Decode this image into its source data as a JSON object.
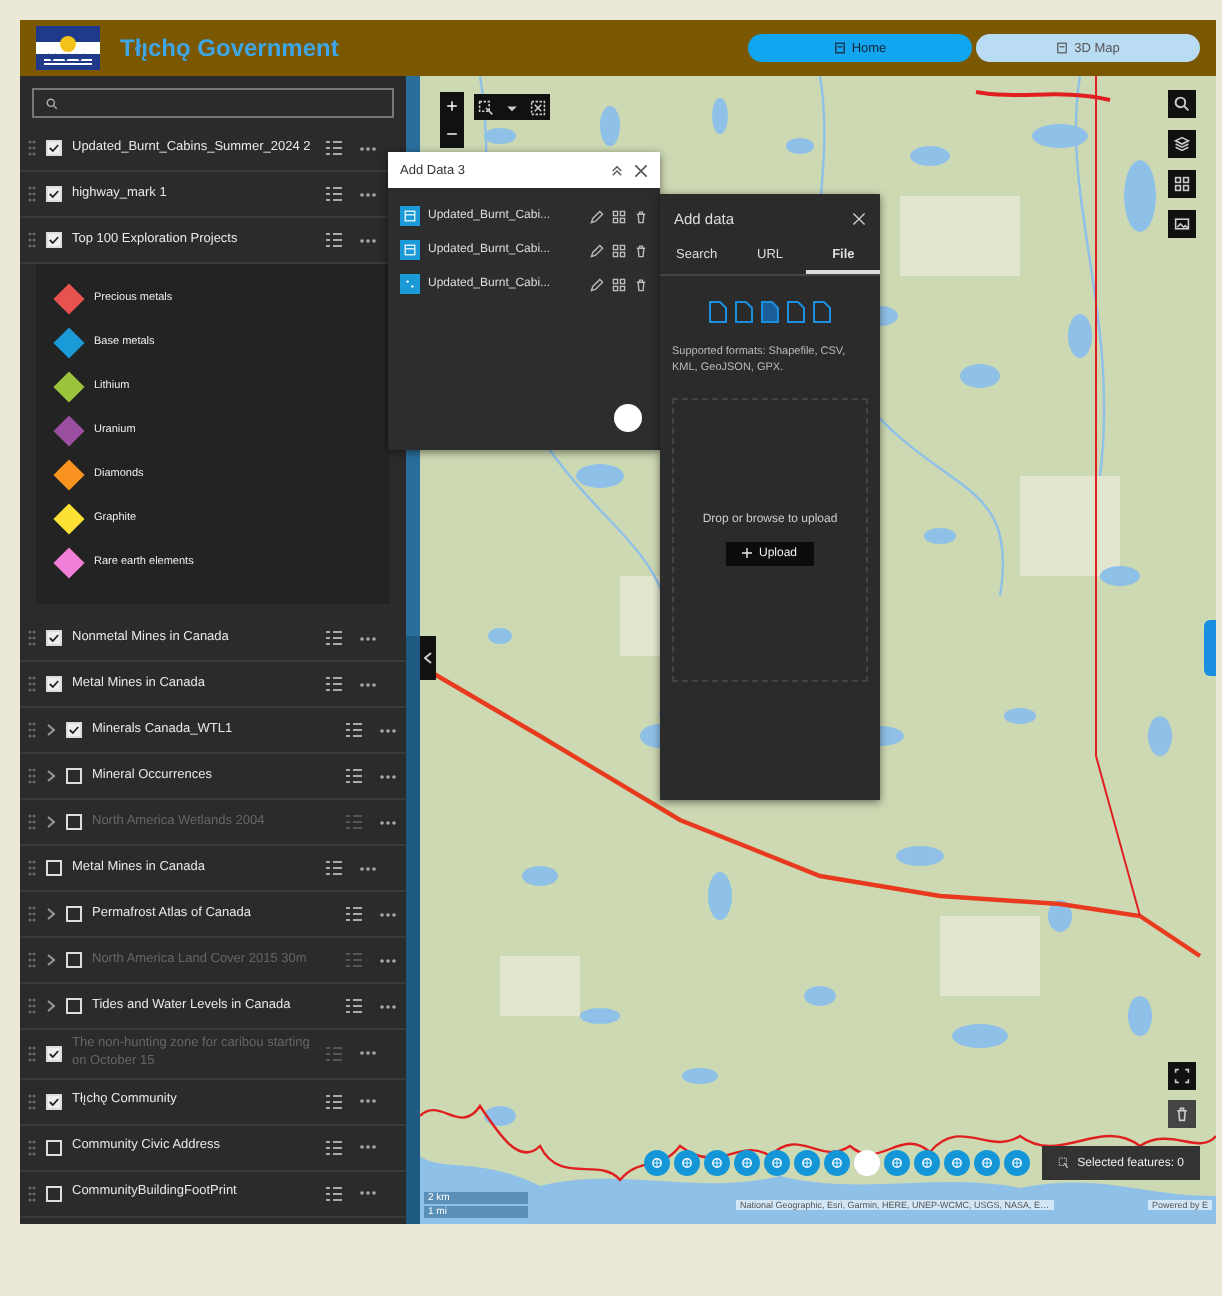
{
  "header": {
    "title": "Tłı̨chǫ Government",
    "tabs": [
      {
        "label": "Home",
        "selected": true
      },
      {
        "label": "3D Map",
        "selected": false
      }
    ]
  },
  "layer_list": {
    "layers": [
      {
        "name": "Updated_Burnt_Cabins_Summer_2024 2",
        "checked": true,
        "has_sublayers": false,
        "dimmed": false
      },
      {
        "name": "highway_mark 1",
        "checked": true,
        "has_sublayers": false,
        "dimmed": false
      },
      {
        "name": "Top 100 Exploration Projects",
        "checked": true,
        "has_sublayers": false,
        "dimmed": false,
        "legend": [
          {
            "label": "Precious metals",
            "color": "#e8534f"
          },
          {
            "label": "Base metals",
            "color": "#1a9bd7"
          },
          {
            "label": "Lithium",
            "color": "#9bc33b"
          },
          {
            "label": "Uranium",
            "color": "#9b4fa0"
          },
          {
            "label": "Diamonds",
            "color": "#f7931e"
          },
          {
            "label": "Graphite",
            "color": "#fde135"
          },
          {
            "label": "Rare earth elements",
            "color": "#f07fd8"
          }
        ]
      },
      {
        "name": "Nonmetal Mines in Canada",
        "checked": true,
        "has_sublayers": false,
        "dimmed": false
      },
      {
        "name": "Metal Mines in Canada",
        "checked": true,
        "has_sublayers": false,
        "dimmed": false
      },
      {
        "name": "Minerals Canada_WTL1",
        "checked": true,
        "has_sublayers": true,
        "dimmed": false
      },
      {
        "name": "Mineral Occurrences",
        "checked": false,
        "has_sublayers": true,
        "dimmed": false
      },
      {
        "name": "North America Wetlands 2004",
        "checked": false,
        "has_sublayers": true,
        "dimmed": true
      },
      {
        "name": "Metal Mines in Canada",
        "checked": false,
        "has_sublayers": false,
        "dimmed": false
      },
      {
        "name": "Permafrost Atlas of Canada",
        "checked": false,
        "has_sublayers": true,
        "dimmed": false
      },
      {
        "name": "North America Land Cover 2015 30m",
        "checked": false,
        "has_sublayers": true,
        "dimmed": true
      },
      {
        "name": "Tides and Water Levels in Canada",
        "checked": false,
        "has_sublayers": true,
        "dimmed": false
      },
      {
        "name": "The non-hunting zone for caribou starting on October 15",
        "checked": true,
        "has_sublayers": false,
        "dimmed": true
      },
      {
        "name": "Tłı̨chǫ Community",
        "checked": true,
        "has_sublayers": false,
        "dimmed": false
      },
      {
        "name": "Community Civic Address",
        "checked": false,
        "has_sublayers": false,
        "dimmed": false
      },
      {
        "name": "CommunityBuildingFootPrint",
        "checked": false,
        "has_sublayers": false,
        "dimmed": false
      }
    ]
  },
  "added_data": {
    "title": "Add Data 3",
    "items": [
      {
        "name": "Updated_Burnt_Cabi...",
        "kind": "table"
      },
      {
        "name": "Updated_Burnt_Cabi...",
        "kind": "table"
      },
      {
        "name": "Updated_Burnt_Cabi...",
        "kind": "points"
      }
    ]
  },
  "add_data": {
    "title": "Add data",
    "tabs": [
      {
        "label": "Search",
        "selected": false
      },
      {
        "label": "URL",
        "selected": false
      },
      {
        "label": "File",
        "selected": true
      }
    ],
    "formats_note": "Supported formats: Shapefile, CSV, KML, GeoJSON, GPX.",
    "drop_hint": "Drop or browse to upload",
    "upload_button": "Upload"
  },
  "map": {
    "scale": [
      "2 km",
      "1 mi"
    ],
    "attribution": "National Geographic, Esri, Garmin, HERE, UNEP-WCMC, USGS, NASA, E…",
    "powered_by": "Powered by E",
    "selection_label": "Selected features: 0"
  }
}
